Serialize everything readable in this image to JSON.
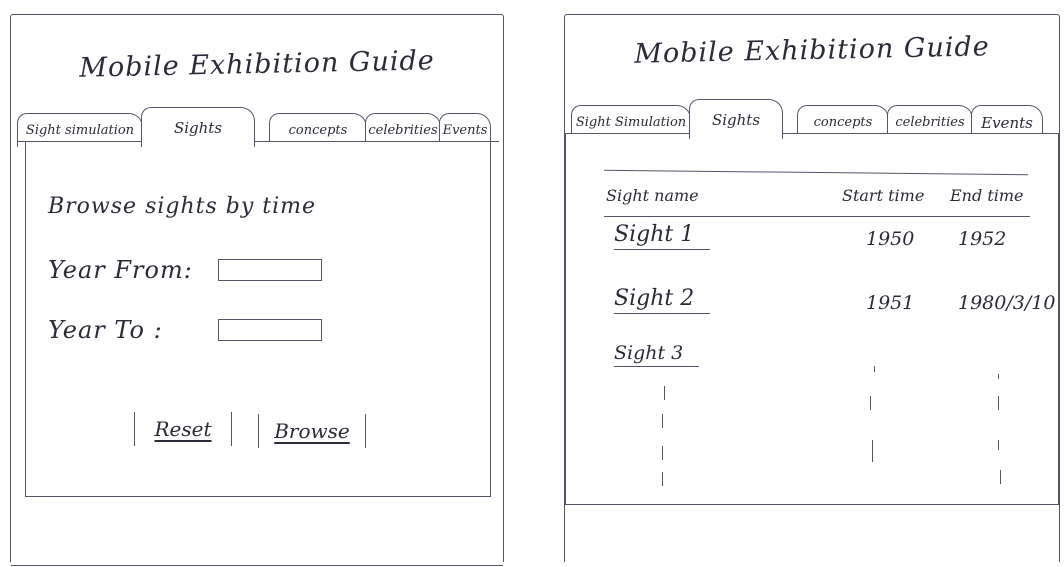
{
  "left_screen": {
    "title": "Mobile Exhibition Guide",
    "tabs": [
      {
        "label": "Sight simulation",
        "active": false
      },
      {
        "label": "Sights",
        "active": true
      },
      {
        "label": "concepts",
        "active": false
      },
      {
        "label": "celebrities",
        "active": false
      },
      {
        "label": "Events",
        "active": false
      }
    ],
    "form": {
      "heading": "Browse sights by time",
      "year_from_label": "Year From:",
      "year_from_value": "",
      "year_to_label": "Year To :",
      "year_to_value": "",
      "reset_label": "Reset",
      "browse_label": "Browse"
    }
  },
  "right_screen": {
    "title": "Mobile Exhibition Guide",
    "tabs": [
      {
        "label": "Sight Simulation",
        "active": false
      },
      {
        "label": "Sights",
        "active": true
      },
      {
        "label": "concepts",
        "active": false
      },
      {
        "label": "celebrities",
        "active": false
      },
      {
        "label": "Events",
        "active": false
      }
    ],
    "table": {
      "headers": [
        "Sight name",
        "Start time",
        "End time"
      ],
      "rows": [
        {
          "name": "Sight 1",
          "start": "1950",
          "end": "1952"
        },
        {
          "name": "Sight 2",
          "start": "1951",
          "end": "1980/3/10"
        },
        {
          "name": "Sight 3",
          "start": "",
          "end": ""
        }
      ]
    }
  },
  "colors": {
    "ink": "#2b2b3a",
    "line": "#55556a",
    "paper": "#ffffff"
  }
}
